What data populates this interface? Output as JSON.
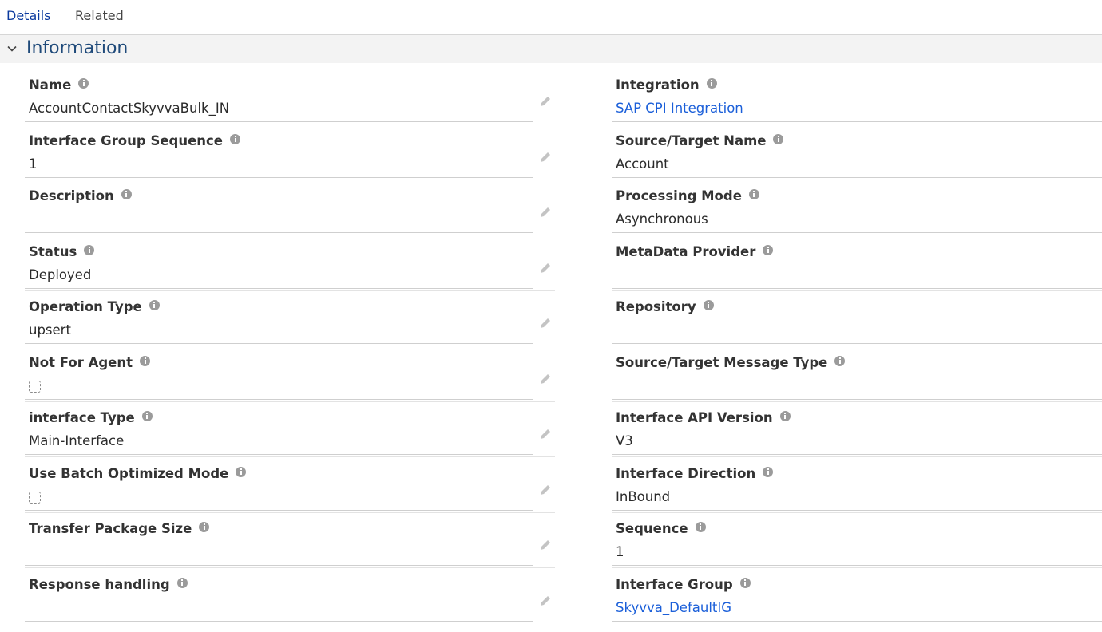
{
  "tabs": [
    {
      "label": "Details"
    },
    {
      "label": "Related"
    }
  ],
  "section": {
    "title": "Information",
    "icon": "chevron-down-icon"
  },
  "colors": {
    "accent": "#1b5fd9",
    "link": "#1b5fd9",
    "header_bg": "#f3f3f3"
  },
  "left_fields": [
    {
      "label": "Name",
      "value": "AccountContactSkyvvaBulk_IN"
    },
    {
      "label": "Interface Group Sequence",
      "value": "1"
    },
    {
      "label": "Description",
      "value": ""
    },
    {
      "label": "Status",
      "value": "Deployed"
    },
    {
      "label": "Operation Type",
      "value": "upsert"
    },
    {
      "label": "Not For Agent",
      "value": "",
      "checked": false
    },
    {
      "label": "interface Type",
      "value": "Main-Interface"
    },
    {
      "label": "Use Batch Optimized Mode",
      "value": "",
      "checked": false
    },
    {
      "label": "Transfer Package Size",
      "value": ""
    },
    {
      "label": "Response handling",
      "value": ""
    }
  ],
  "right_fields": [
    {
      "label": "Integration",
      "value": "SAP CPI Integration"
    },
    {
      "label": "Source/Target Name",
      "value": "Account"
    },
    {
      "label": "Processing Mode",
      "value": "Asynchronous"
    },
    {
      "label": "MetaData Provider",
      "value": ""
    },
    {
      "label": "Repository",
      "value": ""
    },
    {
      "label": "Source/Target Message Type",
      "value": ""
    },
    {
      "label": "Interface API Version",
      "value": "V3"
    },
    {
      "label": "Interface Direction",
      "value": "InBound"
    },
    {
      "label": "Sequence",
      "value": "1"
    },
    {
      "label": "Interface Group",
      "value": "Skyvva_DefaultIG"
    }
  ]
}
